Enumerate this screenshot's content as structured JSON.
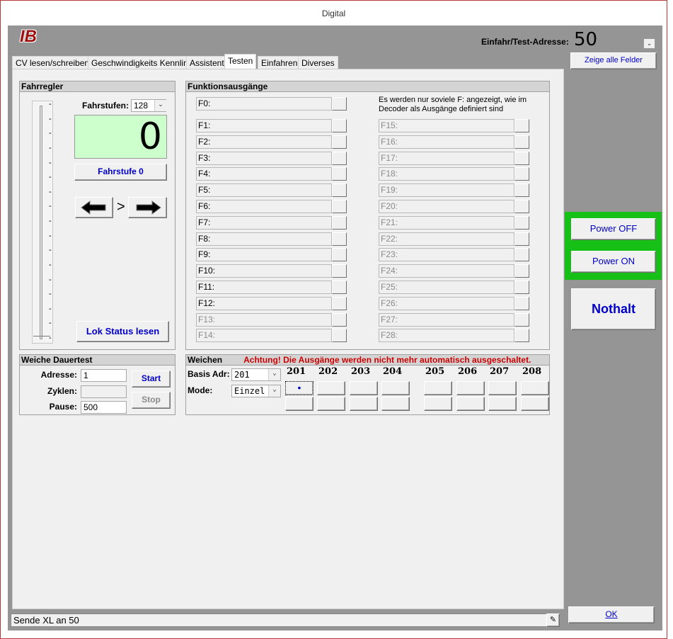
{
  "window": {
    "title": "Digital"
  },
  "header": {
    "logo": "IB",
    "address_label": "Einfahr/Test-Adresse:",
    "address_value": "50"
  },
  "tabs": [
    {
      "label": "CV lesen/schreiben"
    },
    {
      "label": "Geschwindigkeits Kennlinie"
    },
    {
      "label": "Assistent"
    },
    {
      "label": "Testen",
      "active": true
    },
    {
      "label": "Einfahren"
    },
    {
      "label": "Diverses"
    }
  ],
  "fahrregler": {
    "title": "Fahrregler",
    "fahrstufen_label": "Fahrstufen:",
    "fahrstufen_value": "128",
    "speed_display": "0",
    "fahrstufe_button": "Fahrstufe 0",
    "direction_sign": ">",
    "lok_status_button": "Lok Status lesen",
    "slider_ticks": [
      "-",
      "-",
      "-",
      "-",
      "-",
      "-",
      "-",
      "-",
      "-",
      "-",
      "-",
      "-",
      "-",
      "-",
      "-",
      "-",
      "-"
    ]
  },
  "funktionen": {
    "title": "Funktionsausgänge",
    "note": "Es werden nur soviele F: angezeigt, wie im Decoder als Ausgänge definiert sind",
    "f0": "F0:",
    "left": [
      "F1:",
      "F2:",
      "F3:",
      "F4:",
      "F5:",
      "F6:",
      "F7:",
      "F8:",
      "F9:",
      "F10:",
      "F11:",
      "F12:",
      "F13:",
      "F14:"
    ],
    "right": [
      "F15:",
      "F16:",
      "F17:",
      "F18:",
      "F19:",
      "F20:",
      "F21:",
      "F22:",
      "F23:",
      "F24:",
      "F25:",
      "F26:",
      "F27:",
      "F28:"
    ]
  },
  "weiche_dauertest": {
    "title": "Weiche Dauertest",
    "adresse_label": "Adresse:",
    "adresse_value": "1",
    "zyklen_label": "Zyklen:",
    "zyklen_value": "",
    "pause_label": "Pause:",
    "pause_value": "500",
    "start_button": "Start",
    "stop_button": "Stop"
  },
  "weichen": {
    "title": "Weichen",
    "warning": "Achtung! Die Ausgänge werden nicht mehr automatisch ausgeschaltet.",
    "basis_label": "Basis Adr:",
    "basis_value": "201",
    "mode_label": "Mode:",
    "mode_value": "Einzel",
    "columns": [
      "201",
      "202",
      "203",
      "204",
      "205",
      "206",
      "207",
      "208"
    ],
    "active_marker": "•"
  },
  "sidebar": {
    "zeige_button": "Zeige alle Felder",
    "power_off": "Power OFF",
    "power_on": "Power ON",
    "nothalt": "Nothalt",
    "ok": "OK"
  },
  "status": {
    "text": "Sende XL an 50"
  },
  "colors": {
    "accent_green": "#16c016",
    "logo_red": "#9e0f0f",
    "warning_red": "#cc0000",
    "button_blue": "#0000c8",
    "speed_bg": "#ccffcc"
  }
}
